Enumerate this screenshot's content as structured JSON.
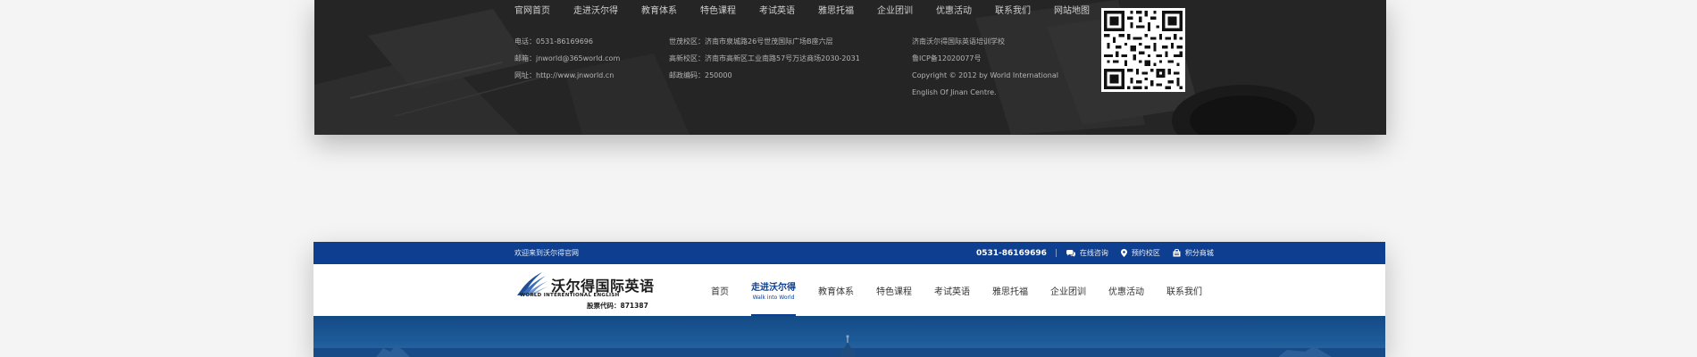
{
  "footer": {
    "nav": [
      "官网首页",
      "走进沃尔得",
      "教育体系",
      "特色课程",
      "考试英语",
      "雅思托福",
      "企业团训",
      "优惠活动",
      "联系我们",
      "网站地图"
    ],
    "contact": [
      "电话：0531-86169696",
      "邮箱：jnworld@365world.com",
      "网址：http://www.jnworld.cn"
    ],
    "campuses": [
      "世茂校区：济南市泉城路26号世茂国际广场B座六层",
      "高新校区：济南市高新区工业南路57号万达商场2030-2031",
      "邮政编码：250000"
    ],
    "company": [
      "济南沃尔得国际英语培训学校",
      "鲁ICP备12020077号",
      "Copyright © 2012 by World International",
      "English Of Jinan Centre."
    ],
    "qr_icon": "qr-code-icon"
  },
  "header": {
    "welcome": "欢迎来到沃尔得官网",
    "phone": "0531-86169696",
    "links": [
      {
        "label": "在线咨询",
        "icon": "chat-icon"
      },
      {
        "label": "预约校区",
        "icon": "location-pin-icon"
      },
      {
        "label": "积分商城",
        "icon": "shop-bag-icon"
      }
    ],
    "logo": {
      "cn": "沃尔得国际英语",
      "en": "WORLD INTERENTIONAL ENGLISH",
      "stock": "股票代码：871387",
      "icon": "wing-logo-icon"
    },
    "nav": [
      {
        "label": "首页",
        "sub": ""
      },
      {
        "label": "走进沃尔得",
        "sub": "Walk into World",
        "active": true
      },
      {
        "label": "教育体系",
        "sub": ""
      },
      {
        "label": "特色课程",
        "sub": ""
      },
      {
        "label": "考试英语",
        "sub": ""
      },
      {
        "label": "雅思托福",
        "sub": ""
      },
      {
        "label": "企业团训",
        "sub": ""
      },
      {
        "label": "优惠活动",
        "sub": ""
      },
      {
        "label": "联系我们",
        "sub": ""
      }
    ]
  },
  "colors": {
    "brand_blue": "#0d3e8f",
    "footer_bg": "#262626",
    "page_bg": "#f4f4f4"
  }
}
